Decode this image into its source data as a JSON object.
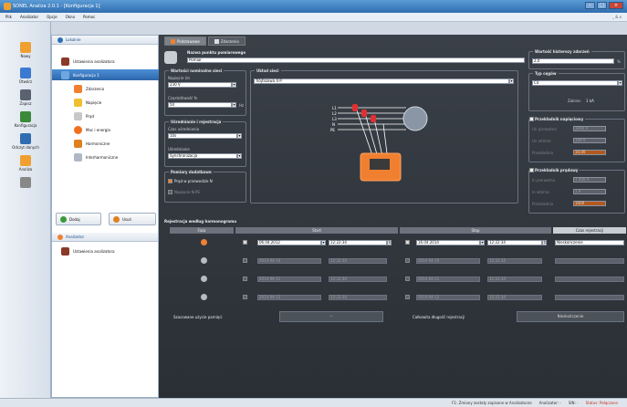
{
  "window": {
    "title": "SONEL Analiza 2.0.1 - [Konfiguracja 1]"
  },
  "menu": {
    "items": [
      "Plik",
      "Analizator",
      "Opcje",
      "Okno",
      "Pomoc"
    ],
    "right": "_ & x"
  },
  "toolbar": {
    "items": [
      {
        "label": "Nowy",
        "icon": "new-icon",
        "color": "#f0a030"
      },
      {
        "label": "Otwórz",
        "icon": "open-icon",
        "color": "#3a7ad0"
      },
      {
        "label": "Zapisz",
        "icon": "save-icon",
        "color": "#5a6270"
      },
      {
        "label": "Konfiguracja",
        "icon": "config-icon",
        "color": "#3a8a3a"
      },
      {
        "label": "Odczyt danych",
        "icon": "chart-icon",
        "color": "#2f6db0"
      },
      {
        "label": "Analiza",
        "icon": "analysis-icon",
        "color": "#f0a030"
      },
      {
        "label": "",
        "icon": "tools-icon",
        "color": "#888888"
      }
    ]
  },
  "tree": {
    "header": "Lokalnie",
    "items": [
      {
        "label": "Ustawienia analizatora",
        "selected": false
      },
      {
        "label": "Konfiguracja 1",
        "selected": true
      },
      {
        "label": "Zdarzenia",
        "selected": false
      },
      {
        "label": "Napięcie",
        "selected": false
      },
      {
        "label": "Prąd",
        "selected": false
      },
      {
        "label": "Moc i energia",
        "selected": false
      },
      {
        "label": "Harmoniczne",
        "selected": false
      },
      {
        "label": "Interharmoniczne",
        "selected": false
      }
    ],
    "btn_add": "Dodaj",
    "btn_delete": "Usuń",
    "analyzer_header": "Analizator",
    "analyzer_item": "Ustawienia analizatora"
  },
  "tabs": [
    {
      "label": "Podstawowe",
      "active": true
    },
    {
      "label": "Zdarzenia",
      "active": false
    }
  ],
  "config": {
    "name_label": "Nazwa punktu pomiarowego",
    "name_value": "Pomiar",
    "nominal_group": "Wartości nominalne sieci",
    "voltage_label": "Napięcie Un",
    "voltage_value": "230 V",
    "freq_label": "Częstotliwość fn",
    "freq_value": "50",
    "freq_unit": "Hz",
    "averaging_group": "Uśrednianie i rejestracja",
    "avg_label": "Czas uśredniania",
    "avg_value": "10s",
    "mode_label": "Uśrednianie",
    "mode_value": "Synchronizacja",
    "network_group": "Układ sieci",
    "network_value": "Trójfazowa 4-P",
    "diagram_labels": [
      "L1",
      "L2",
      "L3",
      "N",
      "PE"
    ],
    "extra_group": "Pomiary dodatkowe",
    "extra_opt1": "Prąd w przewodzie N",
    "extra_opt2": "Napięcie N-PE",
    "hyst_group": "Wartość histerezy zdarzeń",
    "hyst_value": "2,0",
    "hyst_unit": "%",
    "clamp_group": "Typ cęgów",
    "clamp_value": "C4",
    "clamp_range_label": "Zakres:",
    "clamp_range": "1 kA",
    "vtrans_group": "Przekładnik napięciowy",
    "vtrans_rows": [
      {
        "label": "Un pierwotne",
        "value": "1000 V"
      },
      {
        "label": "Un wtórne",
        "value": "100 V"
      },
      {
        "label": "Przekładnia",
        "value": "10,00"
      }
    ],
    "ctrans_group": "Przekładnik prądowy",
    "ctrans_rows": [
      {
        "label": "In pierwotne",
        "value": "1 000 A"
      },
      {
        "label": "In wtórne",
        "value": "1 A"
      },
      {
        "label": "Przekładnia",
        "value": "1000"
      }
    ]
  },
  "schedule": {
    "title": "Rejestracja według harmonogramu",
    "col_phase": "Faza",
    "col_start": "Start",
    "col_stop": "Stop",
    "col_time": "Czas rejestracji",
    "rows": [
      {
        "active": true,
        "start_date": "06.04.2012",
        "start_time": "12:22:34",
        "stop_date": "16.04.2014",
        "stop_time": "12:22:34",
        "duration": "Nieskończenie"
      },
      {
        "active": false,
        "start_date": "2014-04-10",
        "start_time": "12:22:34",
        "stop_date": "2014-04-10",
        "stop_time": "12:22:34",
        "duration": ""
      },
      {
        "active": false,
        "start_date": "2014-04-11",
        "start_time": "12:22:34",
        "stop_date": "2014-04-11",
        "stop_time": "12:22:34",
        "duration": ""
      },
      {
        "active": false,
        "start_date": "2014-04-12",
        "start_time": "12:22:34",
        "stop_date": "2014-04-12",
        "stop_time": "12:22:34",
        "duration": ""
      }
    ],
    "memory_label": "Szacowane użycie pamięci",
    "memory_value": "--",
    "total_label": "Całkowita długość rejestracji",
    "total_value": "Nieskończenie"
  },
  "status": {
    "items": [
      "F1: Zmiany zostały zapisane w Analizatorze",
      "Analizator: -",
      "SIN: -",
      "Status: Połączono"
    ]
  },
  "colors": {
    "accent": "#2f6db0",
    "orange": "#f08030",
    "selected": "#2d66ab"
  }
}
